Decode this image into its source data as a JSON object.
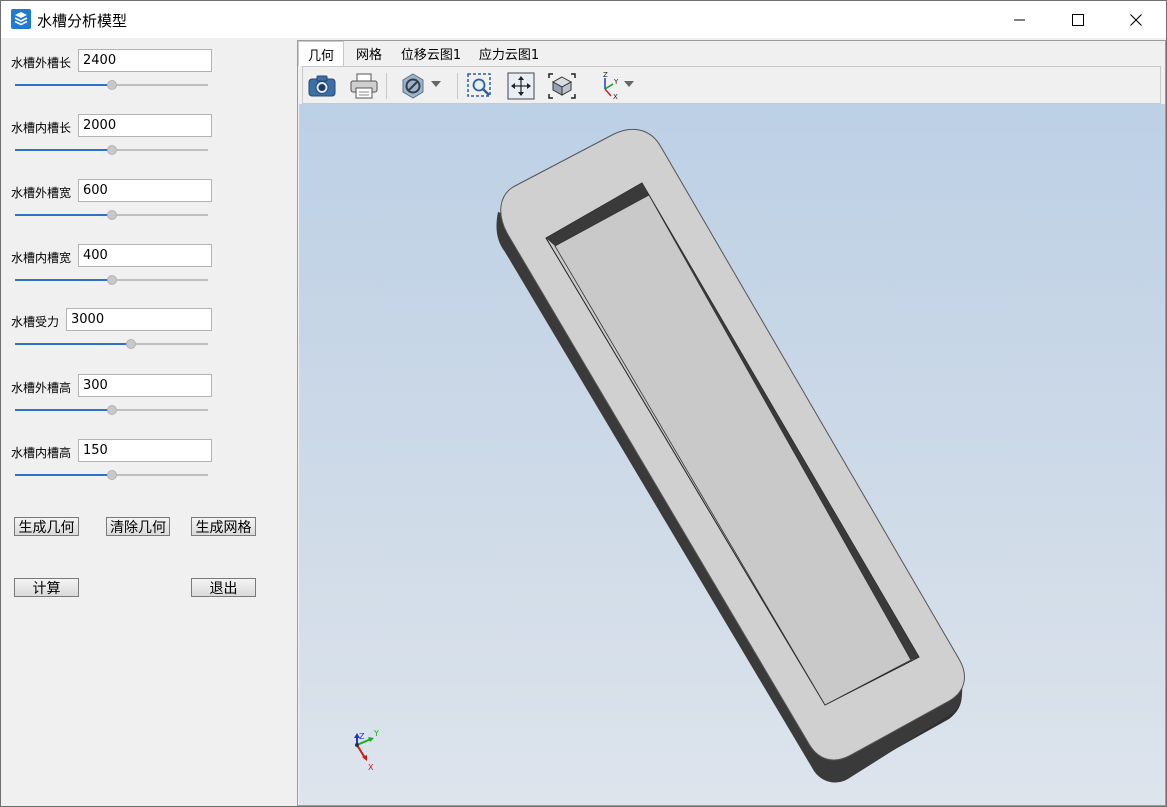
{
  "window": {
    "title": "水槽分析模型",
    "controls": [
      "minimize-icon",
      "maximize-icon",
      "close-icon"
    ]
  },
  "params": [
    {
      "label": "水槽外槽长",
      "value": "2400",
      "slider_fraction": 0.5
    },
    {
      "label": "水槽内槽长",
      "value": "2000",
      "slider_fraction": 0.5
    },
    {
      "label": "水槽外槽宽",
      "value": "600",
      "slider_fraction": 0.5
    },
    {
      "label": "水槽内槽宽",
      "value": "400",
      "slider_fraction": 0.5
    },
    {
      "label": "水槽受力",
      "value": "3000",
      "slider_fraction": 0.6
    },
    {
      "label": "水槽外槽高",
      "value": "300",
      "slider_fraction": 0.5
    },
    {
      "label": "水槽内槽高",
      "value": "150",
      "slider_fraction": 0.5
    }
  ],
  "buttons": {
    "generate_geometry": "生成几何",
    "clear_geometry": "清除几何",
    "generate_mesh": "生成网格",
    "compute": "计算",
    "exit": "退出"
  },
  "tabs": [
    {
      "label": "几何",
      "active": true
    },
    {
      "label": "网格",
      "active": false
    },
    {
      "label": "位移云图1",
      "active": false
    },
    {
      "label": "应力云图1",
      "active": false
    }
  ],
  "toolbar": {
    "icons": [
      "camera-icon",
      "print-icon",
      "display-mode-icon",
      "zoom-window-icon",
      "pan-icon",
      "fit-view-icon",
      "axes-orientation-icon"
    ]
  },
  "axes_triad": {
    "labels": [
      "Z",
      "Y",
      "X"
    ]
  },
  "colors": {
    "slider_fill": "#2f72c4",
    "viewport_top": "#bcd0e6",
    "viewport_bottom": "#dde4ec",
    "model_face": "#d0d0d0",
    "model_side": "#3a3a3a"
  }
}
